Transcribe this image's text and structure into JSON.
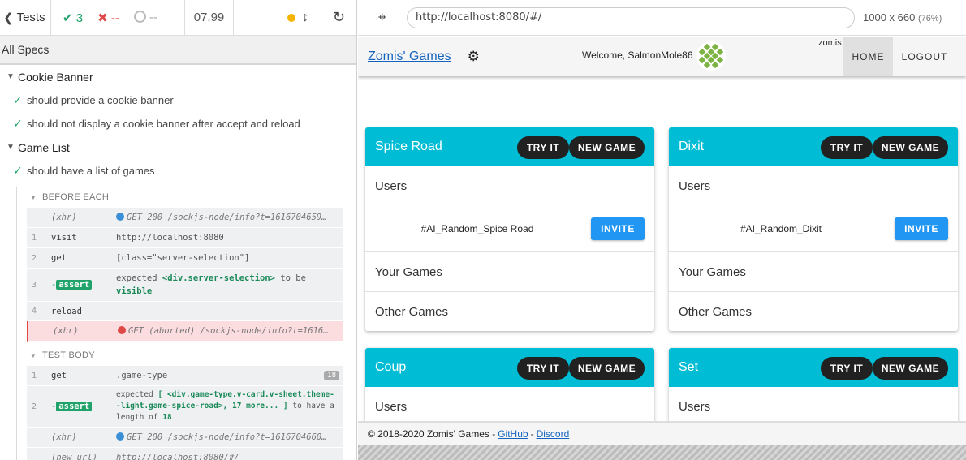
{
  "runner": {
    "tests_label": "Tests",
    "passed": "3",
    "failed": "--",
    "pending": "--",
    "duration": "07.99",
    "all_specs": "All Specs",
    "suites": [
      {
        "title": "Cookie Banner",
        "tests": [
          "should provide a cookie banner",
          "should not display a cookie banner after accept and reload"
        ]
      },
      {
        "title": "Game List",
        "tests": [
          "should have a list of games"
        ]
      }
    ],
    "before_each": {
      "label": "BEFORE EACH",
      "commands": [
        {
          "num": "",
          "name": "(xhr)",
          "msg": "GET 200 /sockjs-node/info?t=1616704659…"
        },
        {
          "num": "1",
          "name": "visit",
          "msg": "http://localhost:8080"
        },
        {
          "num": "2",
          "name": "get",
          "msg": "[class=\"server-selection\"]"
        },
        {
          "num": "3",
          "name": "assert",
          "msg_pre": "expected",
          "msg_el": "<div.server-selection>",
          "msg_mid": "to be",
          "msg_end": "visible"
        },
        {
          "num": "4",
          "name": "reload",
          "msg": ""
        },
        {
          "num": "",
          "name": "(xhr)",
          "msg": "GET (aborted) /sockjs-node/info?t=1616…"
        }
      ]
    },
    "test_body": {
      "label": "TEST BODY",
      "commands": [
        {
          "num": "1",
          "name": "get",
          "msg": ".game-type",
          "count": "18"
        },
        {
          "num": "2",
          "name": "assert",
          "msg_pre": "expected",
          "msg_el": "[ <div.game-type.v-card.v-sheet.theme--light.game-spice-road>, 17 more... ]",
          "msg_mid": "to have a length of",
          "msg_end": "18"
        },
        {
          "num": "",
          "name": "(xhr)",
          "msg": "GET 200 /sockjs-node/info?t=1616704660…"
        },
        {
          "num": "",
          "name": "(new url)",
          "msg": "http://localhost:8080/#/"
        }
      ]
    }
  },
  "aut": {
    "url": "http://localhost:8080/#/",
    "viewport": "1000 x 660",
    "zoom": "(76%)"
  },
  "app": {
    "brand": "Zomis' Games",
    "welcome": "Welcome, SalmonMole86",
    "username": "zomis",
    "nav_home": "HOME",
    "nav_logout": "LOGOUT",
    "try_label": "TRY IT",
    "new_game_label": "NEW GAME",
    "invite_label": "INVITE",
    "users_label": "Users",
    "your_games_label": "Your Games",
    "other_games_label": "Other Games",
    "games": [
      {
        "title": "Spice Road",
        "ai": "#AI_Random_Spice Road"
      },
      {
        "title": "Dixit",
        "ai": "#AI_Random_Dixit"
      },
      {
        "title": "Coup"
      },
      {
        "title": "Set"
      }
    ],
    "footer_text": "© 2018-2020 Zomis' Games -",
    "footer_sep": "-",
    "github": "GitHub",
    "discord": "Discord"
  },
  "colors": {
    "card_header": "#00bcd4",
    "invite": "#2196f3",
    "pass": "#20a36a",
    "fail": "#e04848"
  }
}
